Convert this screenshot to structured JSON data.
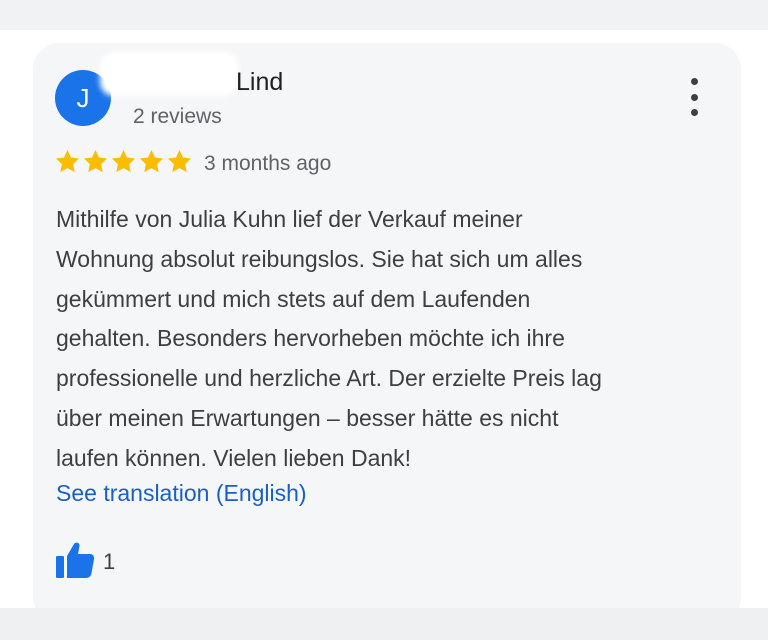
{
  "review": {
    "avatar_initial": "J",
    "author_name": "Lind",
    "review_count": "2 reviews",
    "rating": 5,
    "rating_max": 5,
    "date": "3 months ago",
    "text_lines": [
      "Mithilfe von Julia Kuhn lief der Verkauf meiner",
      "Wohnung absolut reibungslos. Sie hat sich um alles",
      "gekümmert und mich stets auf dem Laufenden",
      "gehalten. Besonders hervorheben möchte ich ihre",
      "professionelle und herzliche Art. Der erzielte Preis lag",
      "über meinen Erwartungen – besser hätte es nicht",
      "laufen können. Vielen lieben Dank!"
    ],
    "translate_link": "See translation (English)",
    "like_count": "1"
  },
  "icons": {
    "more": "more-vert-icon",
    "star": "star-icon",
    "like": "thumbs-up-icon"
  },
  "colors": {
    "avatar": "#1a73e8",
    "star": "#fbbc04",
    "link": "#1a5fc4",
    "like_icon": "#1a73e8",
    "card_background": "#f5f6f8"
  }
}
